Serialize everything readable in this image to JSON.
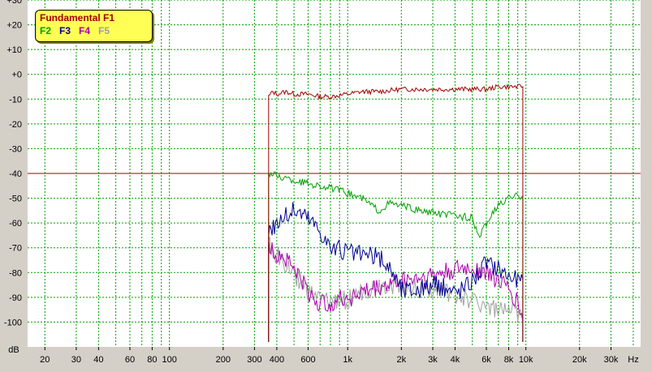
{
  "chart_data": {
    "type": "line",
    "x_scale": "log",
    "xlim": [
      16,
      44000
    ],
    "ylim": [
      -110,
      30
    ],
    "y_ticks": [
      30,
      20,
      10,
      0,
      -10,
      -20,
      -30,
      -40,
      -50,
      -60,
      -70,
      -80,
      -90,
      -100
    ],
    "y_tick_labels": [
      "+30",
      "+20",
      "+10",
      "+0",
      "-10",
      "-20",
      "-30",
      "-40",
      "-50",
      "-60",
      "-70",
      "-80",
      "-90",
      "-100"
    ],
    "ylabel": "dB",
    "x_ticks": [
      20,
      30,
      40,
      60,
      80,
      100,
      200,
      300,
      400,
      600,
      1000,
      2000,
      3000,
      4000,
      6000,
      8000,
      10000,
      20000,
      30000
    ],
    "x_tick_labels": [
      "20",
      "30",
      "40",
      "60",
      "80",
      "100",
      "200",
      "300",
      "400",
      "600",
      "1k",
      "2k",
      "3k",
      "4k",
      "6k",
      "8k",
      "10k",
      "20k",
      "30k"
    ],
    "xlabel": "Hz",
    "grid": true,
    "legend_position": "top-left",
    "threshold": {
      "y": -40,
      "color": "#a00000"
    },
    "series": [
      {
        "name": "Fundamental F1",
        "color": "#a00000",
        "points": [
          [
            360,
            -108
          ],
          [
            360,
            -9
          ],
          [
            380,
            -7
          ],
          [
            400,
            -8
          ],
          [
            450,
            -7
          ],
          [
            500,
            -8
          ],
          [
            600,
            -8
          ],
          [
            700,
            -9
          ],
          [
            800,
            -9
          ],
          [
            1000,
            -8
          ],
          [
            1200,
            -7
          ],
          [
            1500,
            -7
          ],
          [
            2000,
            -6
          ],
          [
            3000,
            -6
          ],
          [
            4000,
            -6
          ],
          [
            5000,
            -6
          ],
          [
            6000,
            -6
          ],
          [
            7000,
            -5
          ],
          [
            8000,
            -5
          ],
          [
            9000,
            -5
          ],
          [
            9600,
            -5
          ],
          [
            9600,
            -108
          ]
        ]
      },
      {
        "name": "F2",
        "color": "#00a000",
        "points": [
          [
            360,
            -108
          ],
          [
            360,
            -40
          ],
          [
            400,
            -41
          ],
          [
            500,
            -43
          ],
          [
            600,
            -44
          ],
          [
            800,
            -46
          ],
          [
            1000,
            -48
          ],
          [
            1200,
            -50
          ],
          [
            1500,
            -55
          ],
          [
            1700,
            -52
          ],
          [
            2000,
            -53
          ],
          [
            2500,
            -55
          ],
          [
            3000,
            -56
          ],
          [
            4000,
            -57
          ],
          [
            5000,
            -58
          ],
          [
            5500,
            -66
          ],
          [
            6000,
            -60
          ],
          [
            7000,
            -53
          ],
          [
            8000,
            -50
          ],
          [
            9000,
            -49
          ],
          [
            9600,
            -49
          ],
          [
            9600,
            -108
          ]
        ]
      },
      {
        "name": "F3",
        "color": "#000090",
        "points": [
          [
            360,
            -108
          ],
          [
            360,
            -63
          ],
          [
            400,
            -60
          ],
          [
            450,
            -57
          ],
          [
            500,
            -55
          ],
          [
            550,
            -56
          ],
          [
            600,
            -58
          ],
          [
            700,
            -63
          ],
          [
            800,
            -70
          ],
          [
            1000,
            -72
          ],
          [
            1200,
            -73
          ],
          [
            1500,
            -74
          ],
          [
            1800,
            -80
          ],
          [
            2000,
            -87
          ],
          [
            2500,
            -87
          ],
          [
            3000,
            -85
          ],
          [
            3500,
            -86
          ],
          [
            4000,
            -88
          ],
          [
            4500,
            -86
          ],
          [
            5000,
            -83
          ],
          [
            6000,
            -76
          ],
          [
            7000,
            -78
          ],
          [
            8000,
            -81
          ],
          [
            9000,
            -83
          ],
          [
            9600,
            -83
          ],
          [
            9600,
            -108
          ]
        ]
      },
      {
        "name": "F4",
        "color": "#b000b0",
        "points": [
          [
            360,
            -108
          ],
          [
            360,
            -70
          ],
          [
            400,
            -72
          ],
          [
            450,
            -74
          ],
          [
            500,
            -78
          ],
          [
            550,
            -83
          ],
          [
            600,
            -88
          ],
          [
            700,
            -93
          ],
          [
            800,
            -92
          ],
          [
            1000,
            -90
          ],
          [
            1200,
            -88
          ],
          [
            1500,
            -86
          ],
          [
            2000,
            -83
          ],
          [
            2500,
            -82
          ],
          [
            3000,
            -81
          ],
          [
            3500,
            -80
          ],
          [
            4000,
            -79
          ],
          [
            5000,
            -78
          ],
          [
            6000,
            -80
          ],
          [
            7000,
            -83
          ],
          [
            8000,
            -87
          ],
          [
            9000,
            -92
          ],
          [
            9600,
            -99
          ],
          [
            9600,
            -108
          ]
        ]
      },
      {
        "name": "F5",
        "color": "#a0a0a0",
        "points": [
          [
            360,
            -108
          ],
          [
            360,
            -68
          ],
          [
            400,
            -73
          ],
          [
            450,
            -77
          ],
          [
            500,
            -81
          ],
          [
            550,
            -84
          ],
          [
            600,
            -88
          ],
          [
            700,
            -91
          ],
          [
            800,
            -92
          ],
          [
            1000,
            -91
          ],
          [
            1200,
            -88
          ],
          [
            1500,
            -85
          ],
          [
            2000,
            -85
          ],
          [
            2500,
            -86
          ],
          [
            3000,
            -87
          ],
          [
            3500,
            -88
          ],
          [
            4000,
            -89
          ],
          [
            5000,
            -91
          ],
          [
            6000,
            -93
          ],
          [
            7000,
            -95
          ],
          [
            8000,
            -96
          ],
          [
            9000,
            -97
          ],
          [
            9600,
            -100
          ],
          [
            9600,
            -108
          ]
        ]
      }
    ]
  }
}
